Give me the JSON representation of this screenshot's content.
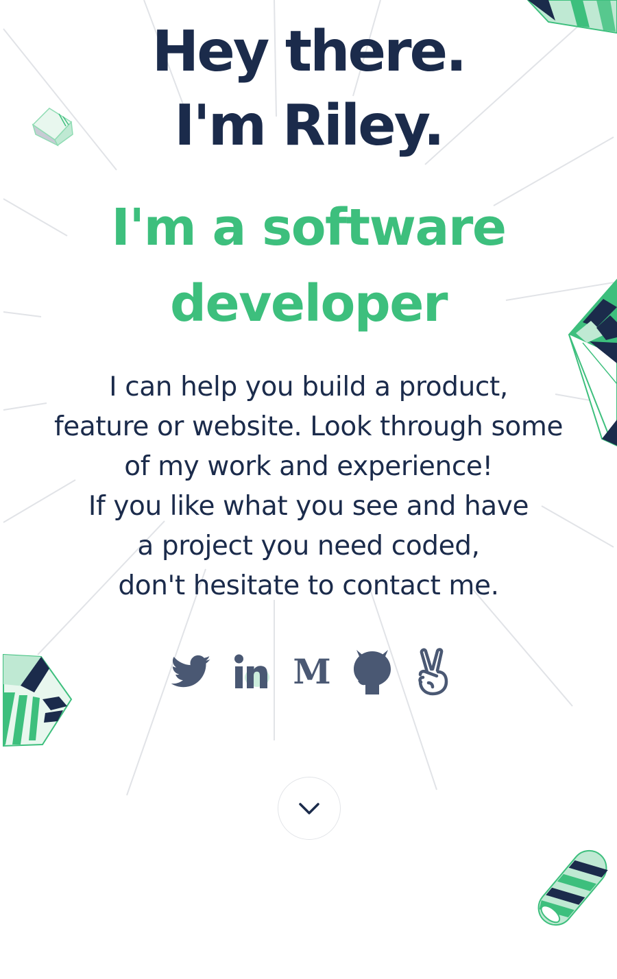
{
  "hero": {
    "greeting_line1": "Hey there.",
    "greeting_line2": "I'm Riley.",
    "role_line1": "I'm a software",
    "role_line2": "developer",
    "intro_lines": [
      "I can help you build a product,",
      "feature or website. Look through some",
      "of my work and experience!",
      "If you like what you see and have",
      "a project you need coded,",
      "don't hesitate to contact me."
    ]
  },
  "socials": [
    {
      "icon": "twitter-icon"
    },
    {
      "icon": "linkedin-icon"
    },
    {
      "icon": "medium-icon"
    },
    {
      "icon": "github-icon"
    },
    {
      "icon": "angellist-icon"
    }
  ],
  "scroll": {
    "icon": "chevron-down-icon"
  },
  "colors": {
    "heading": "#1b2b4b",
    "accent_green": "#3dbf7d",
    "icon_gray": "#4a5873",
    "light_green": "#bfe9d3"
  }
}
